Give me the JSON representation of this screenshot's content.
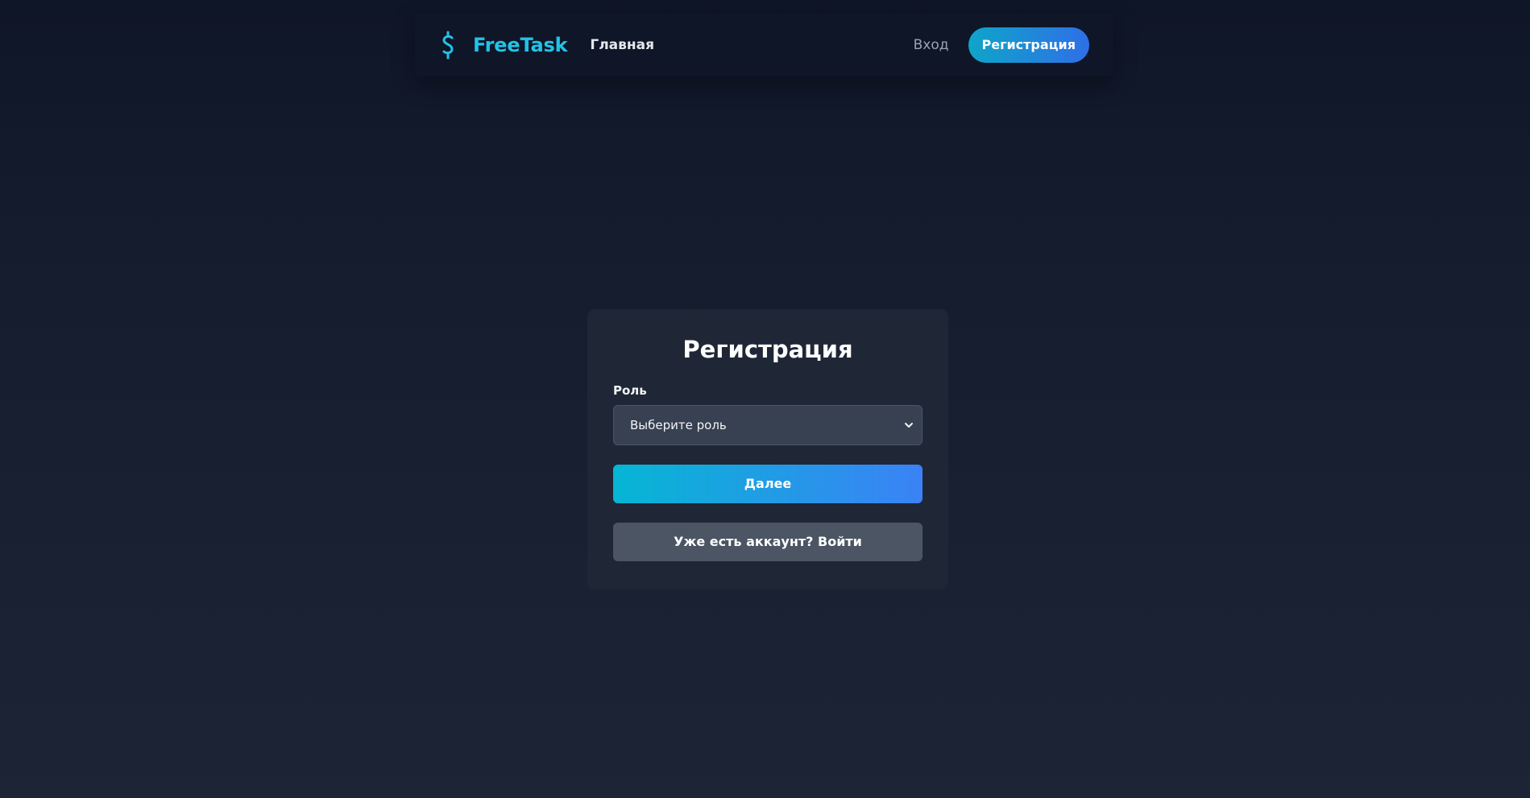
{
  "header": {
    "logo_icon": "dollar-sign-icon",
    "brand": "FreeTask",
    "nav_home": "Главная",
    "nav_login": "Вход",
    "nav_register": "Регистрация"
  },
  "form": {
    "title": "Регистрация",
    "role_label": "Роль",
    "role_select_value": "Выберите роль",
    "next_button": "Далее",
    "login_button": "Уже есть аккаунт? Войти"
  },
  "colors": {
    "accent": "#22c3e6",
    "gradient_start": "#06b6d4",
    "gradient_end": "#3b82f6",
    "background": "#151d2e",
    "card": "#1f2737"
  }
}
